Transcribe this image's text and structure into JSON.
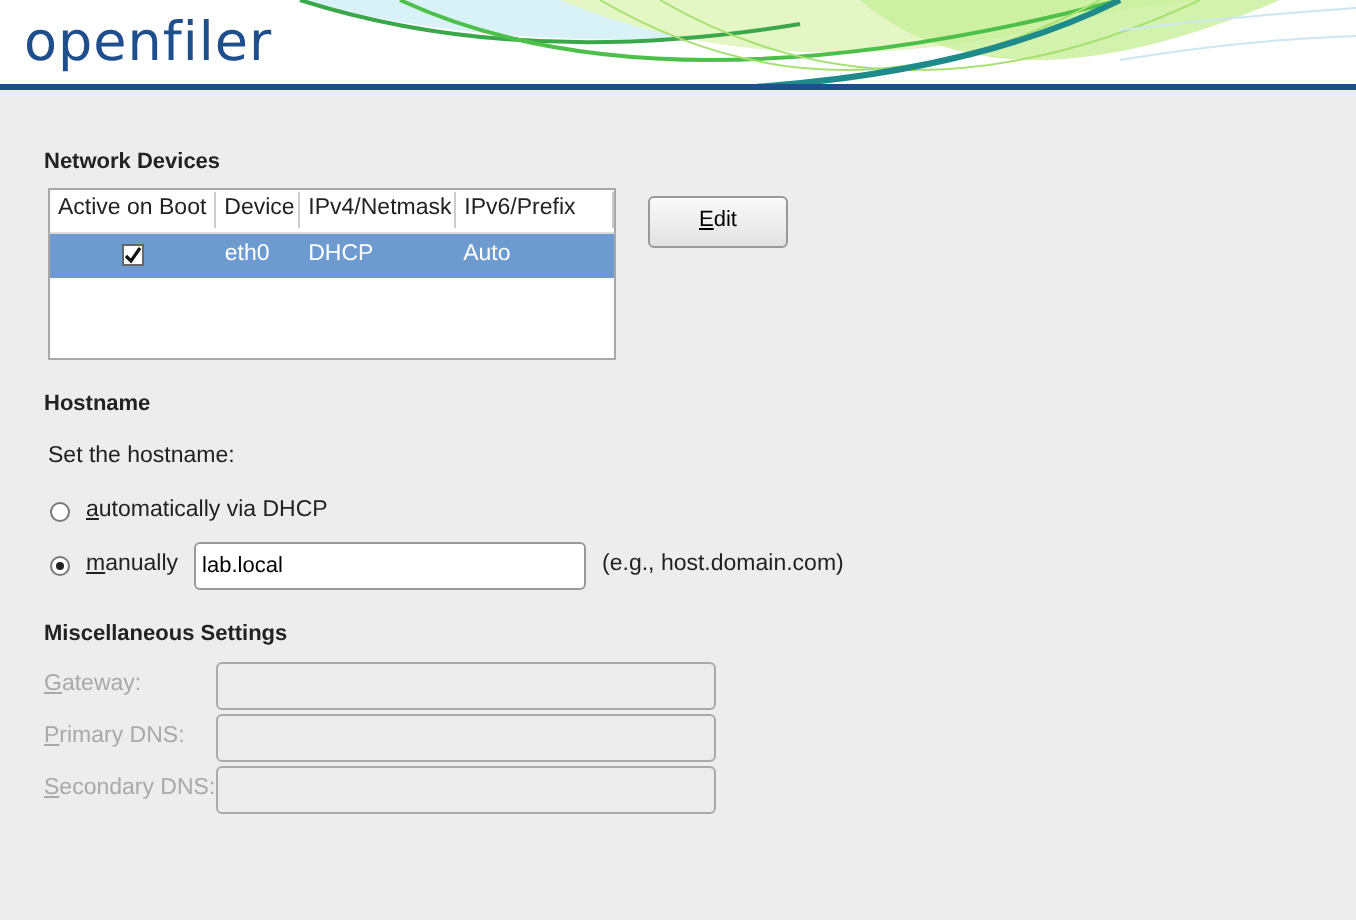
{
  "header": {
    "logo": "openfiler"
  },
  "network_devices": {
    "title": "Network Devices",
    "columns": [
      "Active on Boot",
      "Device",
      "IPv4/Netmask",
      "IPv6/Prefix"
    ],
    "rows": [
      {
        "active_on_boot": true,
        "device": "eth0",
        "ipv4": "DHCP",
        "ipv6": "Auto",
        "selected": true
      }
    ],
    "edit_button": "Edit"
  },
  "hostname": {
    "title": "Hostname",
    "prompt": "Set the hostname:",
    "options": [
      {
        "label": "automatically via DHCP",
        "selected": false
      },
      {
        "label": "manually",
        "selected": true
      }
    ],
    "value": "lab.local",
    "hint": "(e.g., host.domain.com)"
  },
  "misc": {
    "title": "Miscellaneous Settings",
    "fields": [
      {
        "label": "Gateway:",
        "disabled": true
      },
      {
        "label": "Primary DNS:",
        "disabled": true
      },
      {
        "label": "Secondary DNS:",
        "disabled": true
      }
    ]
  }
}
